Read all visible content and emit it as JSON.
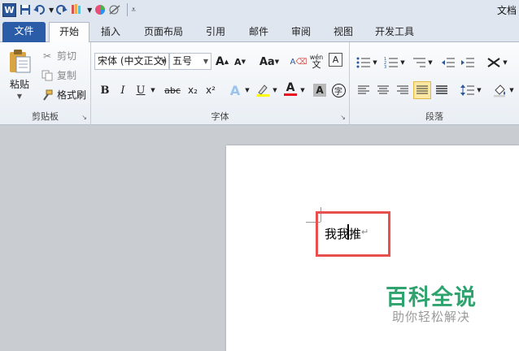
{
  "window": {
    "title": "文档"
  },
  "tabs": {
    "file": "文件",
    "home": "开始",
    "insert": "插入",
    "layout": "页面布局",
    "references": "引用",
    "mailings": "邮件",
    "review": "审阅",
    "view": "视图",
    "developer": "开发工具"
  },
  "clipboard": {
    "paste": "粘贴",
    "cut": "剪切",
    "copy": "复制",
    "format_painter": "格式刷",
    "label": "剪贴板"
  },
  "font": {
    "name": "宋体 (中文正文)",
    "size": "五号",
    "label": "字体",
    "bold": "B",
    "italic": "I",
    "underline": "U",
    "strike": "abc",
    "subscript": "x₂",
    "superscript": "x²",
    "grow": "A",
    "shrink": "A",
    "change_case": "Aa",
    "clear": "A",
    "text_effect": "A",
    "font_color": "A",
    "char_shading": "A",
    "enclose": "字",
    "phonetic": "wén"
  },
  "paragraph": {
    "label": "段落"
  },
  "document": {
    "text": "我我推",
    "para_mark": "↵"
  },
  "watermark": {
    "title": "百科全说",
    "subtitle": "助你轻松解决"
  },
  "colors": {
    "file_tab": "#2a5ca8",
    "highlight": "#e8504e",
    "watermark": "#2ea36d"
  }
}
